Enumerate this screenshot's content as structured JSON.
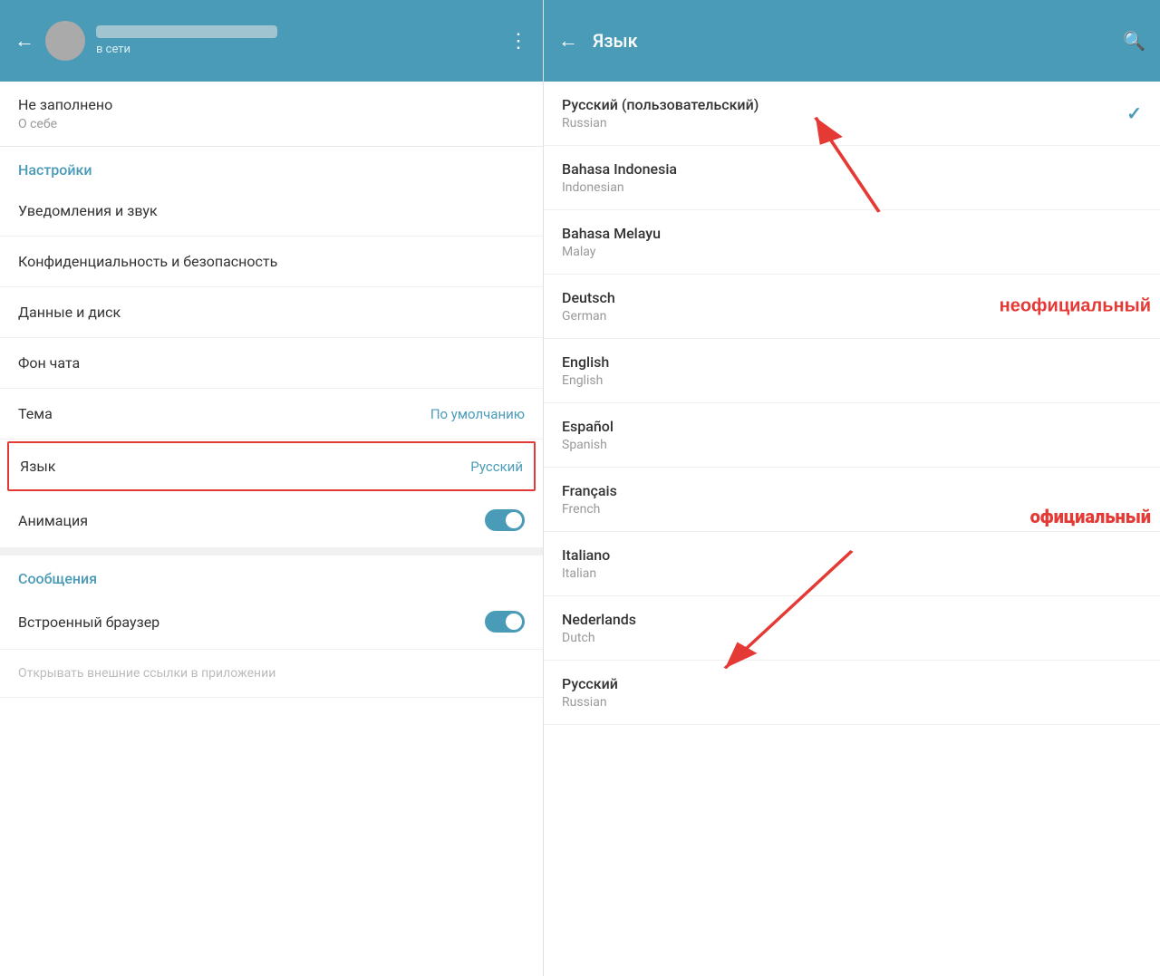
{
  "left": {
    "header": {
      "back_label": "←",
      "contact_status": "в сети",
      "more_label": "⋮"
    },
    "info": {
      "not_filled": "Не заполнено",
      "about": "О себе"
    },
    "settings_label": "Настройки",
    "items": [
      {
        "label": "Уведомления и звук",
        "value": "",
        "type": "text"
      },
      {
        "label": "Конфиденциальность и безопасность",
        "value": "",
        "type": "text"
      },
      {
        "label": "Данные и диск",
        "value": "",
        "type": "text"
      },
      {
        "label": "Фон чата",
        "value": "",
        "type": "text"
      },
      {
        "label": "Тема",
        "value": "По умолчанию",
        "type": "value"
      },
      {
        "label": "Язык",
        "value": "Русский",
        "type": "value",
        "highlighted": true
      },
      {
        "label": "Анимация",
        "value": "",
        "type": "toggle"
      }
    ],
    "messages_label": "Сообщения",
    "messages_items": [
      {
        "label": "Встроенный браузер",
        "value": "",
        "type": "toggle"
      },
      {
        "label": "Открывать внешние ссылки в приложении",
        "value": "",
        "type": "toggle"
      }
    ]
  },
  "right": {
    "header": {
      "back_label": "←",
      "title": "Язык",
      "search_label": "🔍"
    },
    "languages": [
      {
        "native": "Русский (пользовательский)",
        "english": "Russian",
        "selected": true,
        "annotation": ""
      },
      {
        "native": "Bahasa Indonesia",
        "english": "Indonesian",
        "selected": false,
        "annotation": "неофициальный"
      },
      {
        "native": "Bahasa Melayu",
        "english": "Malay",
        "selected": false,
        "annotation": ""
      },
      {
        "native": "Deutsch",
        "english": "German",
        "selected": false,
        "annotation": ""
      },
      {
        "native": "English",
        "english": "English",
        "selected": false,
        "annotation": ""
      },
      {
        "native": "Español",
        "english": "Spanish",
        "selected": false,
        "annotation": ""
      },
      {
        "native": "Français",
        "english": "French",
        "selected": false,
        "annotation": "официальный"
      },
      {
        "native": "Italiano",
        "english": "Italian",
        "selected": false,
        "annotation": ""
      },
      {
        "native": "Nederlands",
        "english": "Dutch",
        "selected": false,
        "annotation": ""
      },
      {
        "native": "Русский",
        "english": "Russian",
        "selected": false,
        "annotation": ""
      }
    ],
    "annotation_unofficial": "неофициальный",
    "annotation_official": "официальный"
  }
}
